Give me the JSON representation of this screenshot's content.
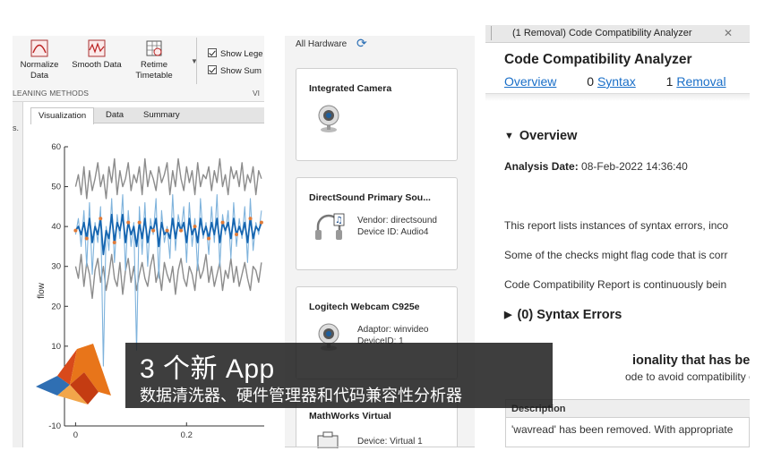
{
  "data_cleaner": {
    "ribbon_buttons": [
      {
        "line1": "Normalize",
        "line2": "Data"
      },
      {
        "line1": "Smooth Data",
        "line2": ""
      },
      {
        "line1": "Retime",
        "line2": "Timetable"
      }
    ],
    "group_label": "LEANING METHODS",
    "group_label_right": "VI",
    "checkboxes": [
      "Show Lege",
      "Show Sum"
    ],
    "side_strip_text": "s.",
    "tabs": [
      "Visualization",
      "Data",
      "Summary"
    ],
    "colors": {
      "raw": "#7fb3dc",
      "smoothed": "#1565b0",
      "bounds": "#8c8c8c",
      "outliers": "#e07b39"
    }
  },
  "chart_data": {
    "type": "line",
    "ylabel": "flow",
    "xlabel": "",
    "ylim": [
      -10,
      60
    ],
    "xlim": [
      -0.02,
      0.34
    ],
    "yticks": [
      -10,
      0,
      10,
      20,
      30,
      40,
      50,
      60
    ],
    "xticks": [
      0,
      0.2
    ],
    "series": [
      {
        "values_desc": "raw"
      },
      {
        "values_desc": "smoothed"
      },
      {
        "values_desc": "upper"
      },
      {
        "values_desc": "lower"
      }
    ],
    "x": [
      0.0,
      0.005,
      0.01,
      0.015,
      0.02,
      0.025,
      0.03,
      0.035,
      0.04,
      0.045,
      0.05,
      0.055,
      0.06,
      0.065,
      0.07,
      0.075,
      0.08,
      0.085,
      0.09,
      0.095,
      0.1,
      0.105,
      0.11,
      0.115,
      0.12,
      0.125,
      0.13,
      0.135,
      0.14,
      0.145,
      0.15,
      0.155,
      0.16,
      0.165,
      0.17,
      0.175,
      0.18,
      0.185,
      0.19,
      0.195,
      0.2,
      0.205,
      0.21,
      0.215,
      0.22,
      0.225,
      0.23,
      0.235,
      0.24,
      0.245,
      0.25,
      0.255,
      0.26,
      0.265,
      0.27,
      0.275,
      0.28,
      0.285,
      0.29,
      0.295,
      0.3,
      0.305,
      0.31,
      0.315,
      0.32,
      0.325,
      0.33,
      0.335
    ],
    "raw": [
      38,
      42,
      35,
      44,
      30,
      46,
      28,
      41,
      36,
      45,
      5,
      40,
      34,
      47,
      31,
      43,
      37,
      48,
      29,
      44,
      35,
      41,
      9,
      45,
      33,
      46,
      30,
      42,
      38,
      47,
      27,
      44,
      36,
      40,
      32,
      48,
      34,
      43,
      39,
      45,
      31,
      46,
      35,
      42,
      29,
      47,
      37,
      41,
      33,
      45,
      36,
      48,
      30,
      43,
      38,
      44,
      32,
      46,
      35,
      42,
      37,
      45,
      31,
      47,
      34,
      41,
      38,
      44
    ],
    "smoothed": [
      39,
      40,
      38,
      41,
      37,
      42,
      36,
      40,
      38,
      42,
      33,
      39,
      37,
      43,
      36,
      41,
      39,
      43,
      36,
      41,
      38,
      40,
      35,
      41,
      37,
      42,
      36,
      40,
      39,
      42,
      35,
      41,
      38,
      39,
      37,
      42,
      37,
      41,
      39,
      41,
      36,
      42,
      38,
      40,
      36,
      42,
      38,
      40,
      37,
      41,
      38,
      42,
      36,
      41,
      39,
      41,
      37,
      42,
      38,
      40,
      38,
      41,
      36,
      42,
      37,
      40,
      39,
      41
    ],
    "upper": [
      50,
      53,
      48,
      55,
      47,
      54,
      49,
      52,
      56,
      50,
      53,
      47,
      55,
      51,
      57,
      48,
      54,
      50,
      52,
      56,
      49,
      53,
      51,
      55,
      48,
      57,
      50,
      54,
      52,
      49,
      55,
      51,
      53,
      56,
      48,
      54,
      50,
      57,
      52,
      49,
      55,
      51,
      54,
      48,
      56,
      50,
      53,
      52,
      55,
      49,
      54,
      51,
      57,
      50,
      53,
      48,
      55,
      52,
      54,
      50,
      56,
      49,
      53,
      51,
      55,
      48,
      54,
      52
    ],
    "lower": [
      30,
      27,
      33,
      25,
      31,
      28,
      22,
      29,
      32,
      26,
      30,
      24,
      28,
      33,
      27,
      25,
      31,
      23,
      29,
      32,
      26,
      30,
      24,
      28,
      31,
      27,
      25,
      30,
      33,
      26,
      29,
      24,
      31,
      28,
      26,
      30,
      23,
      29,
      32,
      27,
      25,
      30,
      28,
      24,
      31,
      27,
      29,
      33,
      26,
      30,
      25,
      28,
      31,
      24,
      29,
      27,
      32,
      26,
      30,
      25,
      28,
      31,
      27,
      24,
      30,
      29,
      26,
      31
    ],
    "outlier_x": [
      0.0,
      0.02,
      0.045,
      0.07,
      0.095,
      0.115,
      0.14,
      0.165,
      0.19,
      0.215,
      0.24,
      0.265,
      0.29,
      0.315,
      0.335
    ]
  },
  "hardware_manager": {
    "header": "All Hardware",
    "cards": [
      {
        "title": "Integrated Camera",
        "info": [],
        "icon": "webcam-icon"
      },
      {
        "title": "DirectSound Primary Sou...",
        "info": [
          "Vendor: directsound",
          "Device ID: Audio4"
        ],
        "icon": "headphones-icon"
      },
      {
        "title": "Logitech Webcam C925e",
        "info": [
          "Adaptor: winvideo",
          "DeviceID: 1"
        ],
        "icon": "webcam-icon"
      },
      {
        "title": "MathWorks Virtual",
        "info": [
          "Device: Virtual 1"
        ],
        "icon": "device-icon"
      }
    ]
  },
  "analyzer": {
    "tab_label": "(1 Removal) Code Compatibility Analyzer",
    "title": "Code Compatibility Analyzer",
    "nav": {
      "overview": "Overview",
      "syntax_count": "0",
      "syntax": "Syntax",
      "removal_count": "1",
      "removal": "Removal"
    },
    "overview_heading": "Overview",
    "analysis_date_label": "Analysis Date:",
    "analysis_date": "08-Feb-2022 14:36:40",
    "lines": [
      "This report lists instances of syntax errors, inco",
      "Some of the checks might flag code that is corr",
      "Code Compatibility Report is continuously bein"
    ],
    "syntax_heading": "(0) Syntax Errors",
    "removed_heading_fragment": "ionality that has been rem",
    "removed_subline_fragment": "ode to avoid compatibility errors.",
    "table_header": "Description",
    "table_row": "'wavread' has been removed. With appropriate"
  },
  "overlay": {
    "title": "3 个新 App",
    "subtitle": "数据清洗器、硬件管理器和代码兼容性分析器"
  }
}
